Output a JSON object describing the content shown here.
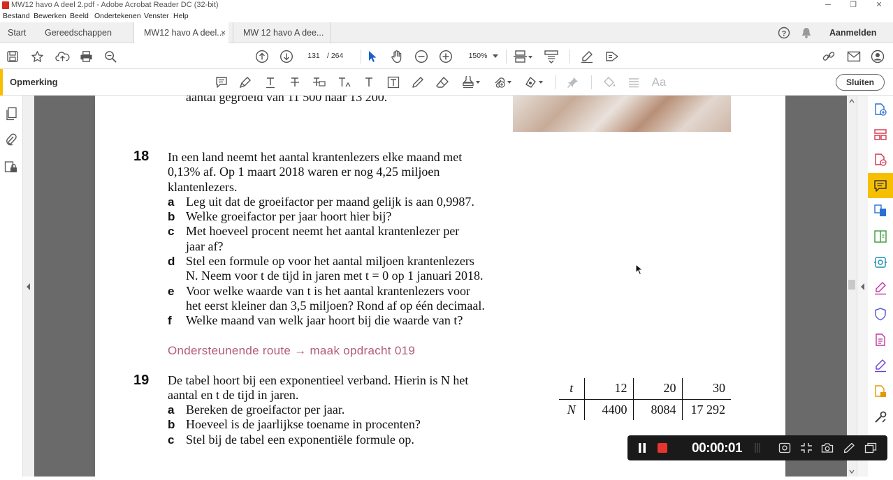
{
  "window": {
    "title": "MW12 havo A deel 2.pdf - Adobe Acrobat Reader DC (32-bit)",
    "minimize": "─",
    "restore": "❐",
    "close": "✕"
  },
  "menu": [
    "Bestand",
    "Bewerken",
    "Beeld",
    "Ondertekenen",
    "Venster",
    "Help"
  ],
  "tabs": {
    "start": "Start",
    "tools": "Gereedschappen",
    "doc1": "MW12 havo A deel...",
    "doc1_close": "×",
    "doc2": "MW 12 havo A dee...",
    "signin": "Aanmelden",
    "help_glyph": "?"
  },
  "toolbar": {
    "page_current": "131",
    "page_total": "/  264",
    "zoom": "150%"
  },
  "comment_bar": {
    "label": "Opmerking",
    "close_label": "Sluiten",
    "font_tool": "Aa"
  },
  "page": {
    "prev_line": "aantal gegroeid van 11 500 naar 13 200.",
    "q18": {
      "number": "18",
      "intro": [
        "In een land neemt het aantal krantenlezers elke maand met",
        "0,13% af. Op 1 maart 2018 waren er nog 4,25 miljoen",
        "klantenlezers."
      ],
      "items": [
        {
          "letter": "a",
          "lines": [
            "Leg uit dat de groeifactor per maand gelijk is aan 0,9987."
          ]
        },
        {
          "letter": "b",
          "lines": [
            "Welke groeifactor per jaar hoort hier bij?"
          ]
        },
        {
          "letter": "c",
          "lines": [
            "Met hoeveel procent neemt het aantal krantenlezer per",
            "jaar af?"
          ]
        },
        {
          "letter": "d",
          "lines": [
            "Stel een formule op voor het aantal miljoen krantenlezers",
            "N. Neem voor t de tijd in jaren met t = 0 op 1 januari 2018."
          ]
        },
        {
          "letter": "e",
          "lines": [
            "Voor welke waarde van t is het aantal krantenlezers voor",
            "het eerst kleiner dan 3,5 miljoen? Rond af op één decimaal."
          ]
        },
        {
          "letter": "f",
          "lines": [
            "Welke maand van welk jaar hoort bij die waarde van t?"
          ]
        }
      ]
    },
    "route": "Ondersteunende route → maak opdracht 019",
    "q19": {
      "number": "19",
      "intro": [
        "De tabel hoort bij een exponentieel verband. Hierin is N het",
        "aantal en t de tijd in jaren."
      ],
      "items": [
        {
          "letter": "a",
          "lines": [
            "Bereken de groeifactor per jaar."
          ]
        },
        {
          "letter": "b",
          "lines": [
            "Hoeveel is de jaarlijkse toename in procenten?"
          ]
        },
        {
          "letter": "c",
          "lines": [
            "Stel bij de tabel een exponentiële formule op."
          ]
        }
      ],
      "table": {
        "row1": {
          "head": "t",
          "values": [
            "12",
            "20",
            "30"
          ]
        },
        "row2": {
          "head": "N",
          "values": [
            "4400",
            "8084",
            "17 292"
          ]
        }
      }
    }
  },
  "recorder": {
    "time": "00:00:01"
  }
}
